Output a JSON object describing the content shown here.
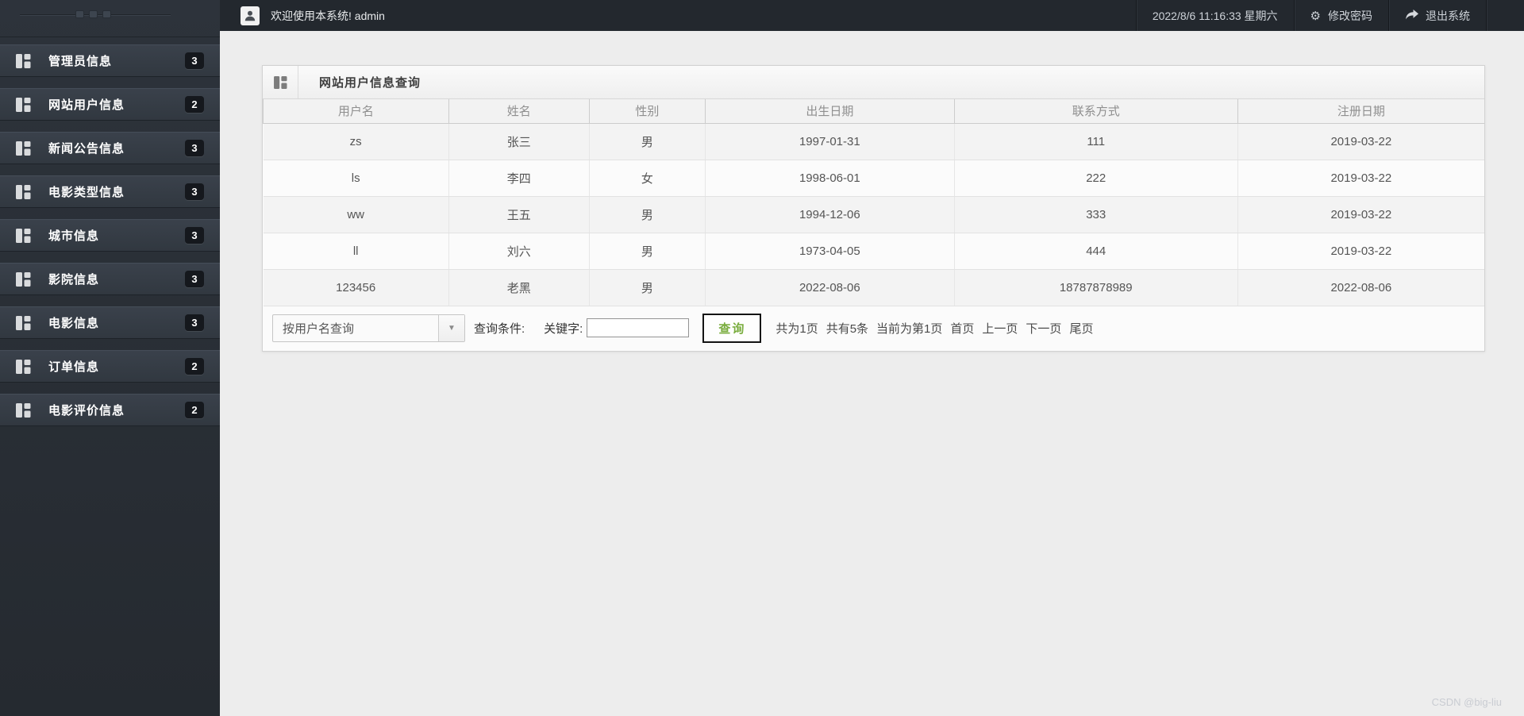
{
  "topbar": {
    "welcome": "欢迎使用本系统! admin",
    "datetime": "2022/8/6 11:16:33 星期六",
    "change_password": "修改密码",
    "logout": "退出系统"
  },
  "sidebar": {
    "items": [
      {
        "label": "管理员信息",
        "badge": "3"
      },
      {
        "label": "网站用户信息",
        "badge": "2"
      },
      {
        "label": "新闻公告信息",
        "badge": "3"
      },
      {
        "label": "电影类型信息",
        "badge": "3"
      },
      {
        "label": "城市信息",
        "badge": "3"
      },
      {
        "label": "影院信息",
        "badge": "3"
      },
      {
        "label": "电影信息",
        "badge": "3"
      },
      {
        "label": "订单信息",
        "badge": "2"
      },
      {
        "label": "电影评价信息",
        "badge": "2"
      }
    ]
  },
  "panel": {
    "title": "网站用户信息查询",
    "table": {
      "headers": [
        "用户名",
        "姓名",
        "性别",
        "出生日期",
        "联系方式",
        "注册日期"
      ],
      "rows": [
        [
          "zs",
          "张三",
          "男",
          "1997-01-31",
          "111",
          "2019-03-22"
        ],
        [
          "ls",
          "李四",
          "女",
          "1998-06-01",
          "222",
          "2019-03-22"
        ],
        [
          "ww",
          "王五",
          "男",
          "1994-12-06",
          "333",
          "2019-03-22"
        ],
        [
          "ll",
          "刘六",
          "男",
          "1973-04-05",
          "444",
          "2019-03-22"
        ],
        [
          "123456",
          "老黑",
          "男",
          "2022-08-06",
          "18787878989",
          "2022-08-06"
        ]
      ]
    },
    "search": {
      "dropdown_value": "按用户名查询",
      "condition_label": "查询条件:",
      "keyword_label": "关键字:",
      "input_value": "",
      "button_label": "查询"
    },
    "pagination": {
      "total_pages": "共为1页",
      "total_records": "共有5条",
      "current_page": "当前为第1页",
      "first": "首页",
      "prev": "上一页",
      "next": "下一页",
      "last": "尾页"
    }
  },
  "icons": {
    "gear": "⚙",
    "dropdown_arrow": "▼"
  },
  "colors": {
    "accent_green": "#7aad3f",
    "topbar_bg": "#23282e",
    "sidebar_bg": "#2a3036",
    "badge_bg": "#15181d"
  },
  "watermark": "CSDN @big-liu"
}
